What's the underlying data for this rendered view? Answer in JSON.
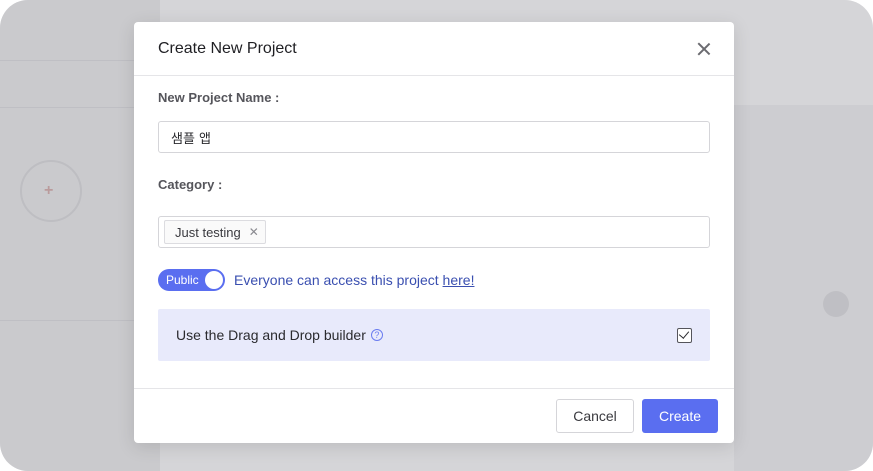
{
  "dialog": {
    "title": "Create New Project"
  },
  "form": {
    "name_label": "New Project Name :",
    "name_value": "샘플 앱",
    "category_label": "Category :",
    "category_tags": [
      "Just testing"
    ],
    "visibility": {
      "toggle_label": "Public",
      "enabled": true,
      "description": "Everyone can access this project ",
      "link_text": "here!"
    },
    "drag_drop": {
      "label": "Use the Drag and Drop builder",
      "help_symbol": "?",
      "checked": true
    }
  },
  "footer": {
    "cancel_label": "Cancel",
    "create_label": "Create"
  },
  "colors": {
    "accent": "#5a6ef0",
    "highlight_bg": "#e8eafb",
    "link": "#3a4fb0"
  }
}
